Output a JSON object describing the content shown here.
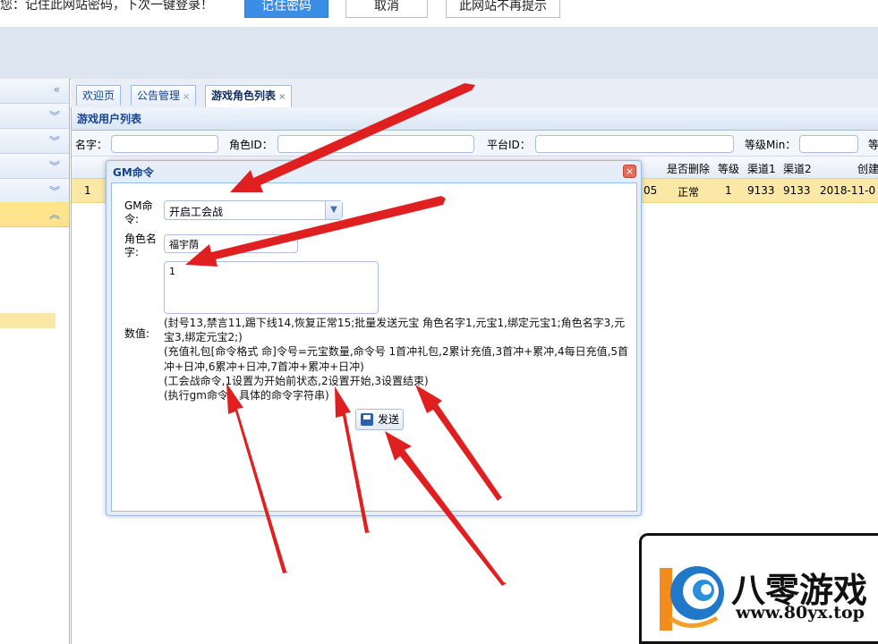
{
  "password_bar": {
    "message": "您：记住此网站密码，下次一键登录！",
    "remember_label": "记住密码",
    "cancel_label": "取消",
    "never_label": "此网站不再提示"
  },
  "tabs": [
    {
      "label": "欢迎页"
    },
    {
      "label": "公告管理",
      "close": "×"
    },
    {
      "label": "游戏角色列表",
      "close": "×"
    }
  ],
  "panel": {
    "title": "游戏用户列表",
    "search": {
      "name_label": "名字：",
      "role_id_label": "角色ID：",
      "platform_id_label": "平台ID：",
      "level_min_label": "等级Min：",
      "extra_label": "等"
    },
    "columns": [
      "是否删除",
      "等级",
      "渠道1",
      "渠道2",
      "创建"
    ],
    "row": {
      "index": "1",
      "partial": "05",
      "deleted": "正常",
      "level": "1",
      "channel1": "9133",
      "channel2": "9133",
      "created": "2018-11-0"
    }
  },
  "dialog": {
    "title": "GM命令",
    "close": "×",
    "gm_label": "GM命令:",
    "gm_value": "开启工会战",
    "role_name_label": "角色名字:",
    "role_name_value": "福宇荫",
    "value_label": "数值:",
    "value_input": "1",
    "hint_lines": [
      "(封号13,禁言11,踢下线14,恢复正常15;批量发送元宝 角色名字1,元宝1,绑定元宝1;角色名字3,元宝3,绑定元宝2;)",
      "(充值礼包[命令格式 命]令号=元宝数量,命令号 1首冲礼包,2累计充值,3首冲+累冲,4每日充值,5首冲+日冲,6累冲+日冲,7首冲+累冲+日冲)",
      "(工会战命令,1设置为开始前状态,2设置开始,3设置结束)",
      "(执行gm命令，具体的命令字符串)"
    ],
    "send_label": "发送"
  },
  "watermark": {
    "title": "八零游戏",
    "url": "www.80yx.top"
  }
}
